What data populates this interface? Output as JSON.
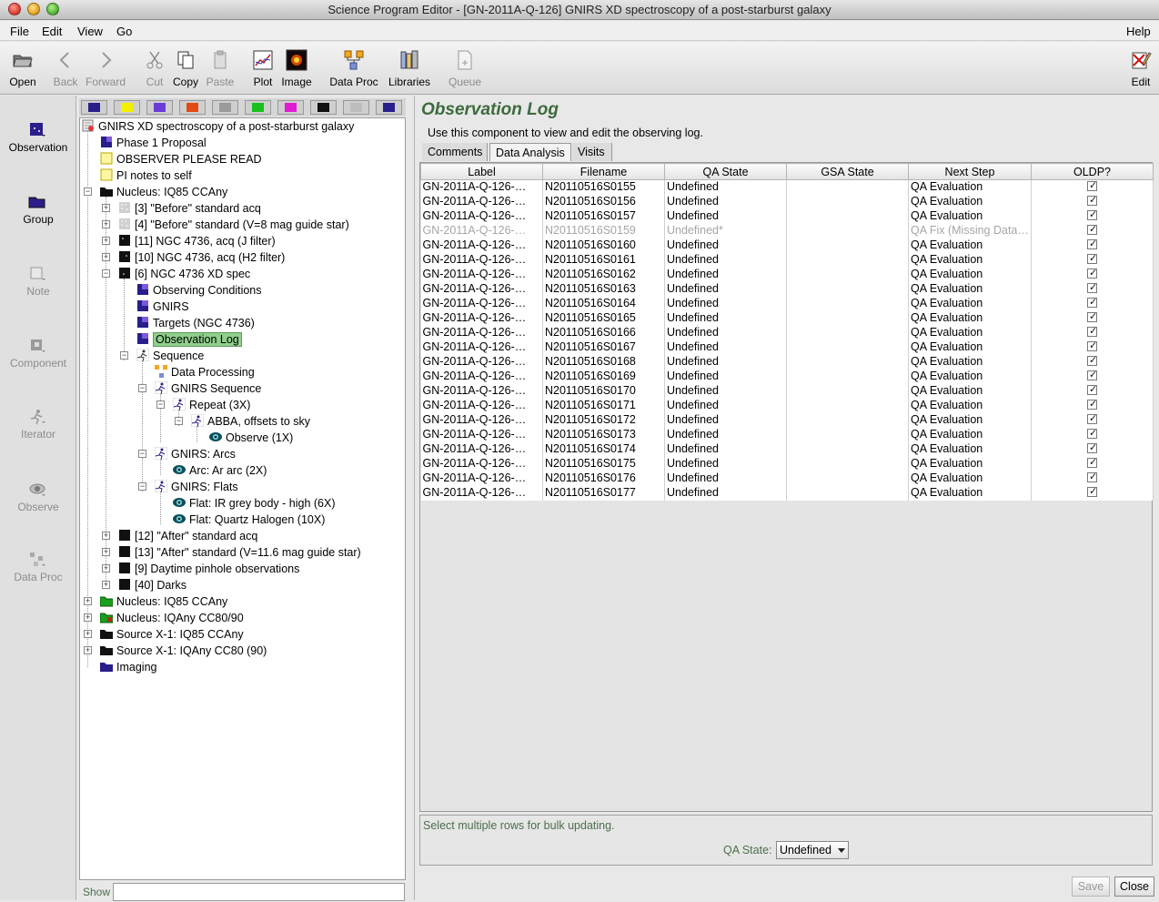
{
  "window": {
    "title": "Science Program Editor - [GN-2011A-Q-126] GNIRS XD spectroscopy of a post-starburst galaxy"
  },
  "menu": {
    "file": "File",
    "edit": "Edit",
    "view": "View",
    "go": "Go",
    "help": "Help"
  },
  "toolbar": {
    "open": "Open",
    "back": "Back",
    "forward": "Forward",
    "cut": "Cut",
    "copy": "Copy",
    "paste": "Paste",
    "plot": "Plot",
    "image": "Image",
    "data_proc": "Data Proc",
    "libraries": "Libraries",
    "queue": "Queue",
    "edit": "Edit"
  },
  "palette": {
    "observation": "Observation",
    "group": "Group",
    "note": "Note",
    "component": "Component",
    "iterator": "Iterator",
    "observe": "Observe",
    "data_proc": "Data Proc"
  },
  "colors": {
    "accent_green": "#3d6b3d",
    "selection_green": "#8fcf8c",
    "filter_buttons": [
      "#2a1e8a",
      "#f3f000",
      "#6b3bd9",
      "#e24a12",
      "#9a9a9a",
      "#18c01c",
      "#e21bd4",
      "#111111",
      "#bdbdbd",
      "#2a1e8a"
    ]
  },
  "tree": {
    "root": "GNIRS XD spectroscopy of a post-starburst galaxy",
    "phase1": "Phase 1 Proposal",
    "observer_note": "OBSERVER PLEASE READ",
    "pi_note": "PI notes to self",
    "group1": "Nucleus: IQ85 CCAny",
    "obs3": "[3] \"Before\" standard acq",
    "obs4": "[4] \"Before\" standard (V=8 mag guide star)",
    "obs11": "[11] NGC 4736, acq (J filter)",
    "obs10": "[10] NGC 4736, acq (H2 filter)",
    "obs6": "[6] NGC 4736 XD spec",
    "obs_conditions": "Observing Conditions",
    "gnirs": "GNIRS",
    "targets": "Targets (NGC 4736)",
    "obs_log": "Observation Log",
    "sequence": "Sequence",
    "data_processing": "Data Processing",
    "gnirs_sequence": "GNIRS Sequence",
    "repeat": "Repeat (3X)",
    "abba": "ABBA, offsets to sky",
    "observe": "Observe (1X)",
    "arcs": "GNIRS: Arcs",
    "arc": "Arc: Ar arc (2X)",
    "flats": "GNIRS: Flats",
    "flat_ir": "Flat: IR grey body - high (6X)",
    "flat_qh": "Flat: Quartz Halogen (10X)",
    "obs12": "[12] \"After\" standard acq",
    "obs13": "[13] \"After\" standard (V=11.6 mag guide star)",
    "obs9": "[9] Daytime pinhole observations",
    "obs40": "[40] Darks",
    "group2": "Nucleus: IQ85 CCAny",
    "group3": "Nucleus: IQAny CC80/90",
    "group4": "Source X-1: IQ85 CCAny",
    "group5": "Source X-1: IQAny CC80 (90)",
    "imaging": "Imaging"
  },
  "show_label": "Show",
  "show_value": "",
  "main": {
    "title": "Observation Log",
    "description": "Use this component to view and edit the observing log.",
    "tabs": [
      "Comments",
      "Data Analysis",
      "Visits"
    ],
    "columns": [
      "Label",
      "Filename",
      "QA State",
      "GSA State",
      "Next Step",
      "OLDP?"
    ],
    "rows": [
      {
        "label": "GN-2011A-Q-126-…",
        "filename": "N20110516S0155",
        "qa": "Undefined",
        "gsa": "",
        "next": "QA Evaluation",
        "oldp": true
      },
      {
        "label": "GN-2011A-Q-126-…",
        "filename": "N20110516S0156",
        "qa": "Undefined",
        "gsa": "",
        "next": "QA Evaluation",
        "oldp": true
      },
      {
        "label": "GN-2011A-Q-126-…",
        "filename": "N20110516S0157",
        "qa": "Undefined",
        "gsa": "",
        "next": "QA Evaluation",
        "oldp": true
      },
      {
        "label": "GN-2011A-Q-126-…",
        "filename": "N20110516S0159",
        "qa": "Undefined*",
        "gsa": "",
        "next": "QA Fix (Missing Data…",
        "oldp": true,
        "disabled": true
      },
      {
        "label": "GN-2011A-Q-126-…",
        "filename": "N20110516S0160",
        "qa": "Undefined",
        "gsa": "",
        "next": "QA Evaluation",
        "oldp": true
      },
      {
        "label": "GN-2011A-Q-126-…",
        "filename": "N20110516S0161",
        "qa": "Undefined",
        "gsa": "",
        "next": "QA Evaluation",
        "oldp": true
      },
      {
        "label": "GN-2011A-Q-126-…",
        "filename": "N20110516S0162",
        "qa": "Undefined",
        "gsa": "",
        "next": "QA Evaluation",
        "oldp": true
      },
      {
        "label": "GN-2011A-Q-126-…",
        "filename": "N20110516S0163",
        "qa": "Undefined",
        "gsa": "",
        "next": "QA Evaluation",
        "oldp": true
      },
      {
        "label": "GN-2011A-Q-126-…",
        "filename": "N20110516S0164",
        "qa": "Undefined",
        "gsa": "",
        "next": "QA Evaluation",
        "oldp": true
      },
      {
        "label": "GN-2011A-Q-126-…",
        "filename": "N20110516S0165",
        "qa": "Undefined",
        "gsa": "",
        "next": "QA Evaluation",
        "oldp": true
      },
      {
        "label": "GN-2011A-Q-126-…",
        "filename": "N20110516S0166",
        "qa": "Undefined",
        "gsa": "",
        "next": "QA Evaluation",
        "oldp": true
      },
      {
        "label": "GN-2011A-Q-126-…",
        "filename": "N20110516S0167",
        "qa": "Undefined",
        "gsa": "",
        "next": "QA Evaluation",
        "oldp": true
      },
      {
        "label": "GN-2011A-Q-126-…",
        "filename": "N20110516S0168",
        "qa": "Undefined",
        "gsa": "",
        "next": "QA Evaluation",
        "oldp": true
      },
      {
        "label": "GN-2011A-Q-126-…",
        "filename": "N20110516S0169",
        "qa": "Undefined",
        "gsa": "",
        "next": "QA Evaluation",
        "oldp": true
      },
      {
        "label": "GN-2011A-Q-126-…",
        "filename": "N20110516S0170",
        "qa": "Undefined",
        "gsa": "",
        "next": "QA Evaluation",
        "oldp": true
      },
      {
        "label": "GN-2011A-Q-126-…",
        "filename": "N20110516S0171",
        "qa": "Undefined",
        "gsa": "",
        "next": "QA Evaluation",
        "oldp": true
      },
      {
        "label": "GN-2011A-Q-126-…",
        "filename": "N20110516S0172",
        "qa": "Undefined",
        "gsa": "",
        "next": "QA Evaluation",
        "oldp": true
      },
      {
        "label": "GN-2011A-Q-126-…",
        "filename": "N20110516S0173",
        "qa": "Undefined",
        "gsa": "",
        "next": "QA Evaluation",
        "oldp": true
      },
      {
        "label": "GN-2011A-Q-126-…",
        "filename": "N20110516S0174",
        "qa": "Undefined",
        "gsa": "",
        "next": "QA Evaluation",
        "oldp": true
      },
      {
        "label": "GN-2011A-Q-126-…",
        "filename": "N20110516S0175",
        "qa": "Undefined",
        "gsa": "",
        "next": "QA Evaluation",
        "oldp": true
      },
      {
        "label": "GN-2011A-Q-126-…",
        "filename": "N20110516S0176",
        "qa": "Undefined",
        "gsa": "",
        "next": "QA Evaluation",
        "oldp": true
      },
      {
        "label": "GN-2011A-Q-126-…",
        "filename": "N20110516S0177",
        "qa": "Undefined",
        "gsa": "",
        "next": "QA Evaluation",
        "oldp": true
      }
    ],
    "bulk_message": "Select multiple rows for bulk updating.",
    "qa_state_label": "QA State:",
    "qa_state_value": "Undefined",
    "save": "Save",
    "close": "Close"
  }
}
